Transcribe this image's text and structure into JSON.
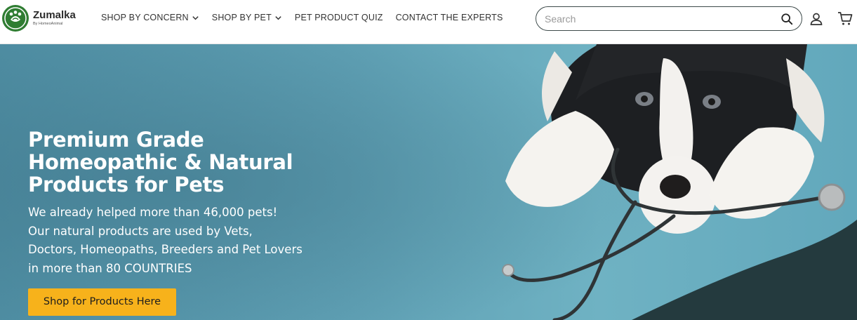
{
  "brand": {
    "name": "Zumalka",
    "tagline": "By HomeoAnimal",
    "primary_color": "#2f7d32",
    "accent_color": "#f7b21b"
  },
  "nav": {
    "items": [
      {
        "label": "SHOP BY CONCERN",
        "dropdown": true
      },
      {
        "label": "SHOP BY PET",
        "dropdown": true
      },
      {
        "label": "PET PRODUCT QUIZ",
        "dropdown": false
      },
      {
        "label": "CONTACT THE EXPERTS",
        "dropdown": false
      }
    ]
  },
  "search": {
    "placeholder": "Search",
    "value": "",
    "icon": "search-icon"
  },
  "header_icons": {
    "account": "account-icon",
    "cart": "cart-icon"
  },
  "hero": {
    "title": "Premium Grade Homeopathic & Natural Products for Pets",
    "lines": [
      "We already helped more than 46,000 pets!",
      "Our natural products are used by Vets,",
      "Doctors, Homeopaths, Breeders and Pet Lovers",
      "in more than 80 COUNTRIES"
    ],
    "cta_label": "Shop for Products Here",
    "image": "dog-with-stethoscope"
  }
}
